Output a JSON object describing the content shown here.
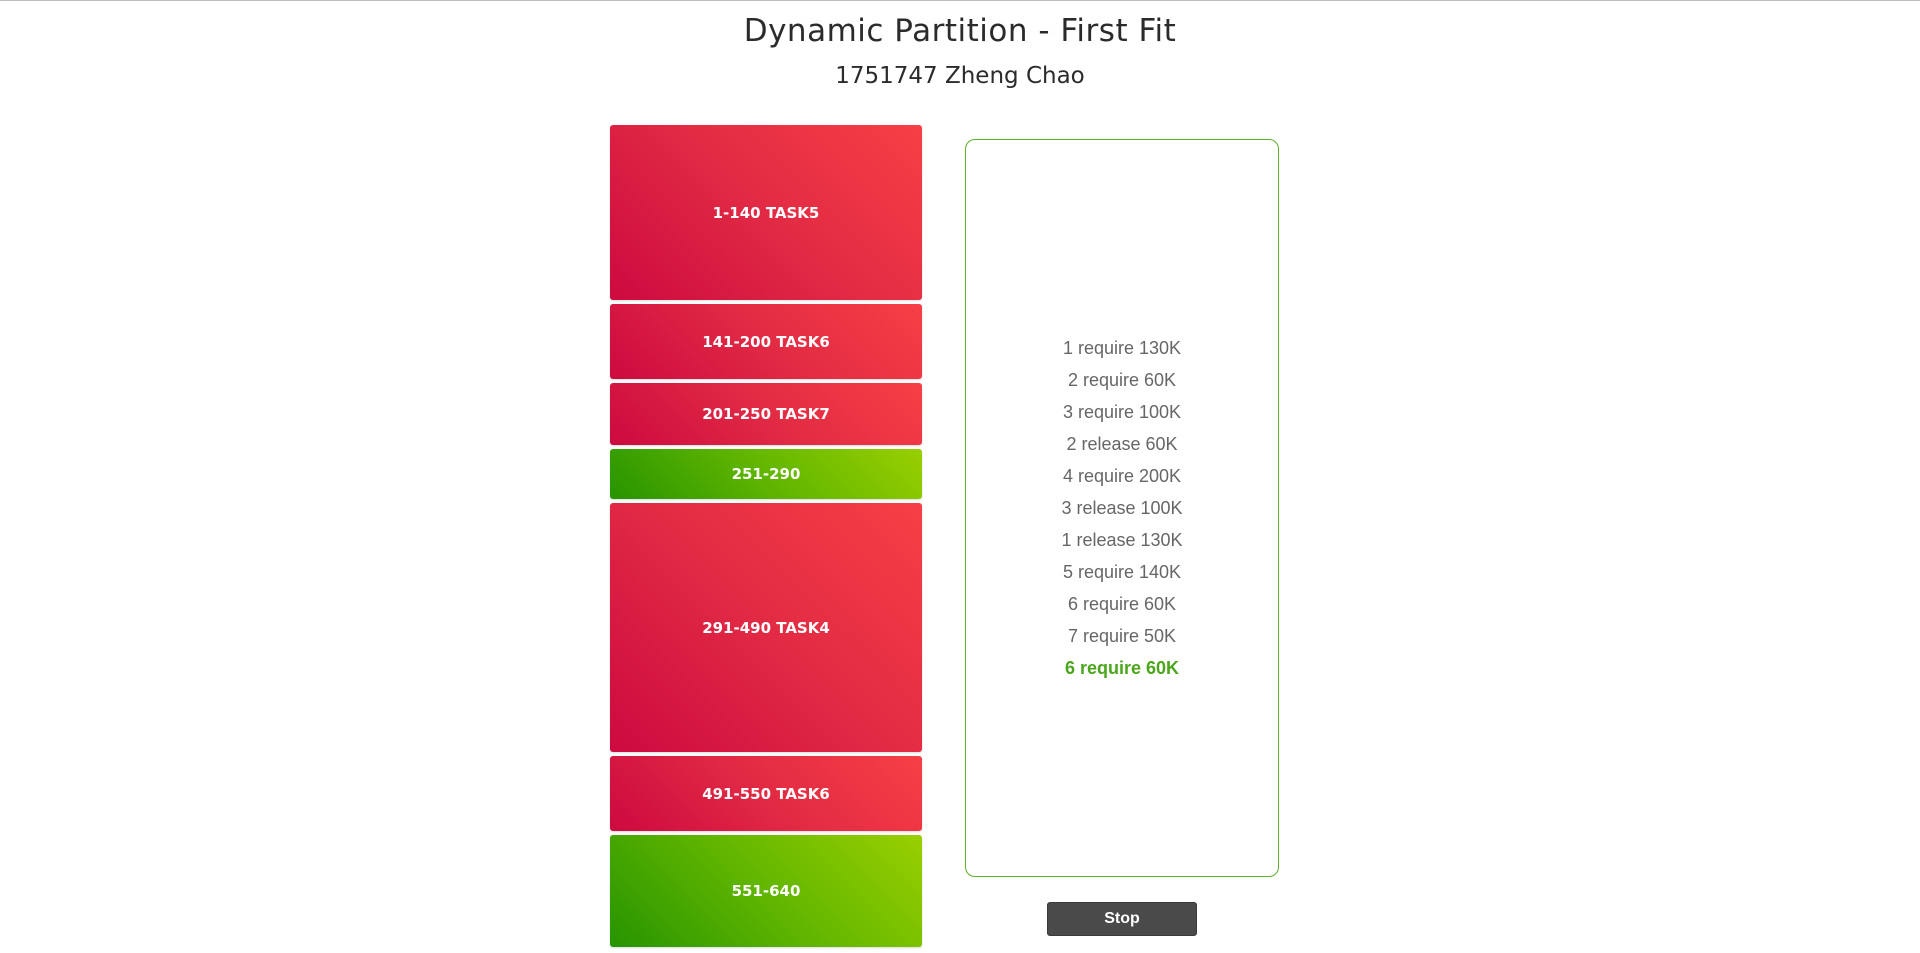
{
  "header": {
    "title": "Dynamic Partition - First Fit",
    "subtitle": "1751747 Zheng Chao"
  },
  "memory": {
    "total_k": 640,
    "blocks": [
      {
        "label": "1-140 TASK5",
        "start": 1,
        "end": 140,
        "task": "TASK5",
        "state": "used"
      },
      {
        "label": "141-200 TASK6",
        "start": 141,
        "end": 200,
        "task": "TASK6",
        "state": "used"
      },
      {
        "label": "201-250 TASK7",
        "start": 201,
        "end": 250,
        "task": "TASK7",
        "state": "used"
      },
      {
        "label": "251-290",
        "start": 251,
        "end": 290,
        "task": "",
        "state": "free"
      },
      {
        "label": "291-490 TASK4",
        "start": 291,
        "end": 490,
        "task": "TASK4",
        "state": "used"
      },
      {
        "label": "491-550 TASK6",
        "start": 491,
        "end": 550,
        "task": "TASK6",
        "state": "used"
      },
      {
        "label": "551-640",
        "start": 551,
        "end": 640,
        "task": "",
        "state": "free"
      }
    ],
    "colors": {
      "used": "#e0253f",
      "free": "#6cbc00"
    }
  },
  "log": {
    "lines": [
      "1 require 130K",
      "2 require 60K",
      "3 require 100K",
      "2 release 60K",
      "4 require 200K",
      "3 release 100K",
      "1 release 130K",
      "5 require 140K",
      "6 require 60K",
      "7 require 50K"
    ],
    "current": "6 require 60K",
    "border_color": "#5fb02b",
    "current_color": "#4aa61a"
  },
  "controls": {
    "stop_label": "Stop"
  }
}
